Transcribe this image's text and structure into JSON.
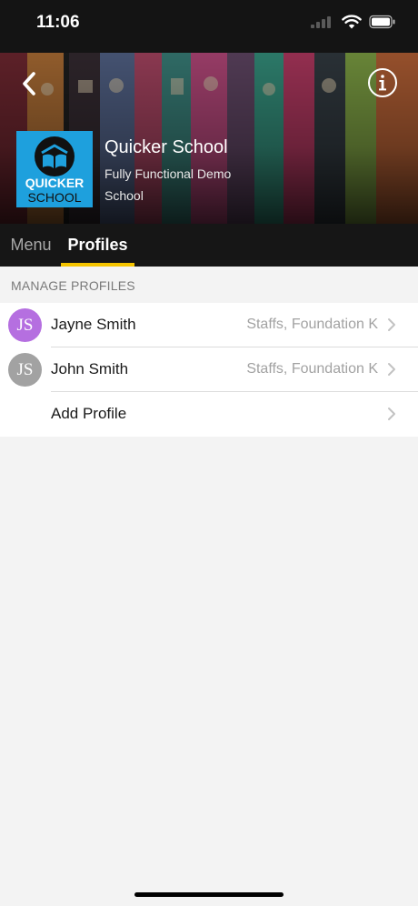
{
  "status_bar": {
    "time": "11:06",
    "icons": [
      "signal-icon",
      "wifi-icon",
      "battery-icon"
    ]
  },
  "header": {
    "school_name": "Quicker School",
    "subtitle": "Fully Functional Demo School",
    "logo_text_top": "QUICKER",
    "logo_text_bottom": "SCHOOL",
    "back_icon": "chevron-left-icon",
    "info_icon": "info-icon"
  },
  "tabs": [
    {
      "label": "Menu",
      "active": false
    },
    {
      "label": "Profiles",
      "active": true
    }
  ],
  "section": {
    "title": "MANAGE PROFILES"
  },
  "profiles": [
    {
      "initials": "JS",
      "name": "Jayne Smith",
      "detail": "Staffs, Foundation K",
      "avatar_color": "#b56fe0"
    },
    {
      "initials": "JS",
      "name": "John Smith",
      "detail": "Staffs, Foundation K",
      "avatar_color": "#a2a2a2"
    }
  ],
  "add_profile": {
    "label": "Add Profile"
  },
  "colors": {
    "accent": "#f5c400",
    "tab_bar": "#161616",
    "background": "#f3f3f3",
    "logo_blue": "#1ea0dd"
  }
}
